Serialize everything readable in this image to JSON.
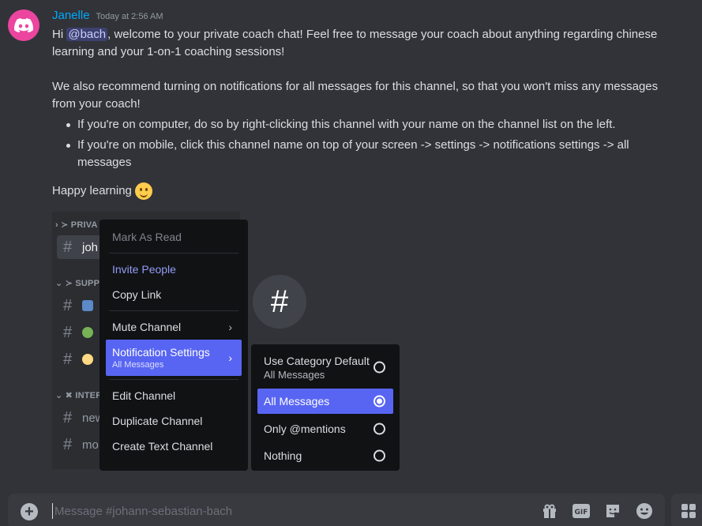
{
  "message": {
    "author": "Janelle",
    "timestamp": "Today at 2:56 AM",
    "greeting_prefix": "Hi",
    "mention": "@bach",
    "line1_rest": ", welcome to your private coach chat! Feel free to message your coach about anything regarding chinese learning and your 1-on-1 coaching sessions!",
    "line2": "We also recommend turning on notifications for all messages for this channel, so that you won't miss any messages from your coach!",
    "bullets": [
      "If you're on computer, do so by right-clicking this channel with your name on the channel list on the left.",
      "If you're on mobile, click this channel name on top of your screen -> settings -> notifications settings -> all messages"
    ],
    "signoff": "Happy learning"
  },
  "embed": {
    "categories": [
      "PRIVA",
      "SUPP",
      "INTER"
    ],
    "channels": [
      {
        "label": "joh",
        "active": true
      },
      {
        "label": ""
      },
      {
        "label": ""
      },
      {
        "label": ""
      },
      {
        "label": "new"
      },
      {
        "label": "mo"
      }
    ],
    "big_icon": "#",
    "context_menu": {
      "mark_as_read": "Mark As Read",
      "invite_people": "Invite People",
      "copy_link": "Copy Link",
      "mute_channel": "Mute Channel",
      "notification_settings": "Notification Settings",
      "notification_current": "All Messages",
      "edit_channel": "Edit Channel",
      "duplicate_channel": "Duplicate Channel",
      "create_text_channel": "Create Text Channel"
    },
    "notification_menu": {
      "options": [
        {
          "label": "Use Category Default",
          "sub": "All Messages",
          "checked": false
        },
        {
          "label": "All Messages",
          "checked": true
        },
        {
          "label": "Only @mentions",
          "checked": false
        },
        {
          "label": "Nothing",
          "checked": false
        }
      ]
    }
  },
  "composer": {
    "placeholder": "Message #johann-sebastian-bach"
  },
  "icons": {
    "composer": [
      "plus-circle-icon",
      "gift-icon",
      "gif-icon",
      "sticker-icon",
      "emoji-icon",
      "apps-icon"
    ]
  },
  "colors": {
    "accent": "#5865f2",
    "author": "#00a8fc",
    "avatar": "#eb459f"
  }
}
